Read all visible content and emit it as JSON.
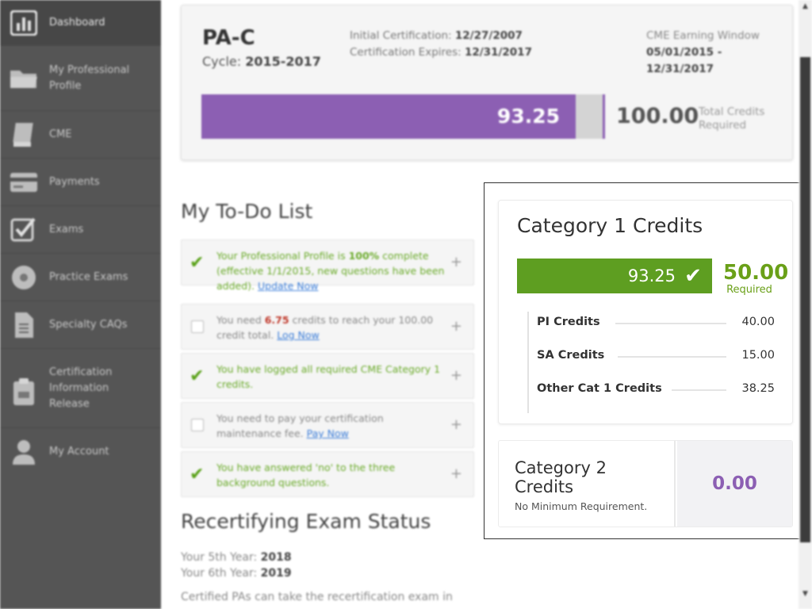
{
  "sidebar": {
    "items": [
      {
        "label": "Dashboard",
        "icon": "bar-chart-icon",
        "active": true
      },
      {
        "label": "My Professional Profile",
        "icon": "folder-icon"
      },
      {
        "label": "CME",
        "icon": "book-icon"
      },
      {
        "label": "Payments",
        "icon": "credit-card-icon"
      },
      {
        "label": "Exams",
        "icon": "checkbox-icon"
      },
      {
        "label": "Practice Exams",
        "icon": "disc-icon"
      },
      {
        "label": "Specialty CAQs",
        "icon": "document-icon"
      },
      {
        "label": "Certification Information Release",
        "icon": "clipboard-icon"
      },
      {
        "label": "My Account",
        "icon": "user-icon"
      }
    ]
  },
  "certification": {
    "title": "PA-C",
    "cycle_label": "Cycle:",
    "cycle_value": "2015-2017",
    "initial_label": "Initial Certification:",
    "initial_value": "12/27/2007",
    "expires_label": "Certification Expires:",
    "expires_value": "12/31/2017",
    "window_label": "CME Earning Window",
    "window_start": "05/01/2015 -",
    "window_end": "12/31/2017",
    "progress_value": "93.25",
    "progress_fraction": 0.9325,
    "total_value": "100.00",
    "total_label": "Total Credits Required",
    "progress_color": "#8c5fb3"
  },
  "todo": {
    "title": "My To-Do List",
    "items": [
      {
        "done": true,
        "text_a": "Your Professional Profile is ",
        "bold": "100%",
        "text_b": " complete (effective 1/1/2015, new questions have been added). ",
        "link": "Update Now"
      },
      {
        "done": false,
        "text_a": "You need ",
        "highlight": "6.75",
        "text_b": " credits to reach your 100.00 credit total. ",
        "link": "Log Now"
      },
      {
        "done": true,
        "text_a": "You have logged all required CME Category 1 credits.",
        "text_b": "",
        "link": ""
      },
      {
        "done": false,
        "text_a": "You need to pay your certification maintenance fee. ",
        "text_b": "",
        "link": "Pay Now"
      },
      {
        "done": true,
        "text_a": "You have answered 'no' to the three background questions.",
        "text_b": "",
        "link": ""
      }
    ]
  },
  "exam_status": {
    "title": "Recertifying Exam Status",
    "fifth_label": "Your 5th Year:",
    "fifth_value": "2018",
    "sixth_label": "Your 6th Year:",
    "sixth_value": "2019",
    "note": "Certified PAs can take the recertification exam in"
  },
  "category1": {
    "title": "Category 1 Credits",
    "earned": "93.25",
    "required_value": "50.00",
    "required_label": "Required",
    "bar_color": "#5e9e21",
    "credits": [
      {
        "label": "PI Credits",
        "value": "40.00"
      },
      {
        "label": "SA Credits",
        "value": "15.00"
      },
      {
        "label": "Other Cat 1 Credits",
        "value": "38.25"
      }
    ]
  },
  "category2": {
    "title": "Category 2 Credits",
    "subtitle": "No Minimum Requirement.",
    "value": "0.00",
    "value_color": "#8c5fb3"
  }
}
